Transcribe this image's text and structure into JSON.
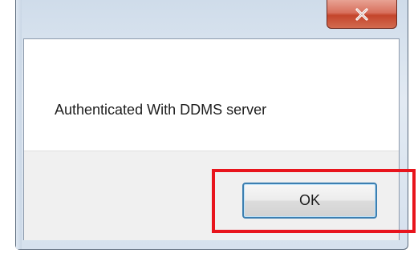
{
  "dialog": {
    "title": "",
    "message": "Authenticated With DDMS server",
    "ok_label": "OK",
    "close_icon": "close-icon"
  },
  "annotation": {
    "highlight_color": "#e8141c"
  }
}
